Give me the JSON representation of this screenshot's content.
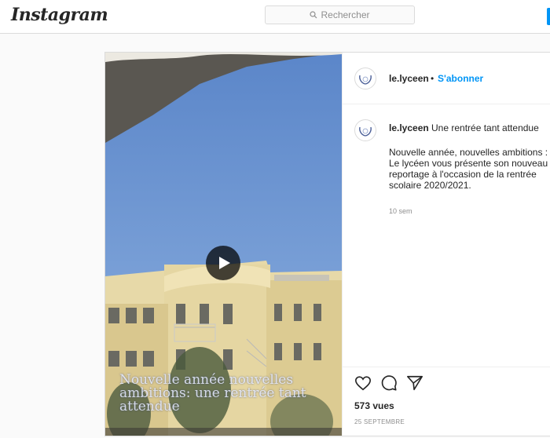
{
  "header": {
    "logo": "Instagram",
    "search_placeholder": "Rechercher"
  },
  "post": {
    "video_overlay_text": "Nouvelle année nouvelles ambitions: une rentrée tant attendue",
    "author": {
      "username": "le.lyceen",
      "separator": "•",
      "follow_label": "S'abonner"
    },
    "caption": {
      "username": "le.lyceen",
      "title": "Une rentrée tant attendue",
      "body": "Nouvelle année, nouvelles ambitions :\nLe lycéen vous présente son nouveau\nreportage à l'occasion de la rentrée\nscolaire 2020/2021.",
      "time": "10 sem"
    },
    "stats": {
      "views": "573 vues",
      "date": "25 SEPTEMBRE"
    }
  },
  "icons": [
    "search-icon",
    "play-icon",
    "heart-icon",
    "comment-icon",
    "share-icon"
  ],
  "colors": {
    "accent": "#0095f6",
    "text": "#262626",
    "muted": "#8e8e8e"
  }
}
